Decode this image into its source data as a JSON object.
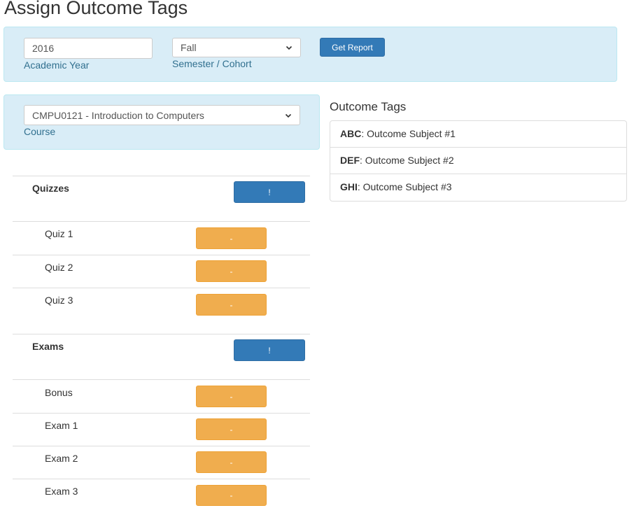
{
  "page": {
    "title": "Assign Outcome Tags"
  },
  "filters": {
    "academic_year": {
      "value": "2016",
      "label": "Academic Year"
    },
    "semester": {
      "value": "Fall",
      "label": "Semester / Cohort"
    },
    "get_report_label": "Get Report"
  },
  "course": {
    "value": "CMPU0121 - Introduction to Computers",
    "label": "Course"
  },
  "outcome_tags": {
    "heading": "Outcome Tags",
    "items": [
      {
        "code": "ABC",
        "subject": ": Outcome Subject #1"
      },
      {
        "code": "DEF",
        "subject": ": Outcome Subject #2"
      },
      {
        "code": "GHI",
        "subject": ": Outcome Subject #3"
      }
    ]
  },
  "groups": [
    {
      "name": "Quizzes",
      "button_label": "!",
      "items": [
        {
          "name": "Quiz 1",
          "button_label": "-"
        },
        {
          "name": "Quiz 2",
          "button_label": "-"
        },
        {
          "name": "Quiz 3",
          "button_label": "-"
        }
      ]
    },
    {
      "name": "Exams",
      "button_label": "!",
      "items": [
        {
          "name": "Bonus",
          "button_label": "-"
        },
        {
          "name": "Exam 1",
          "button_label": "-"
        },
        {
          "name": "Exam 2",
          "button_label": "-"
        },
        {
          "name": "Exam 3",
          "button_label": "-"
        }
      ]
    }
  ],
  "colors": {
    "panel_bg": "#d9edf7",
    "help_text": "#31708f",
    "primary": "#337ab7",
    "warning": "#f0ad4e"
  }
}
